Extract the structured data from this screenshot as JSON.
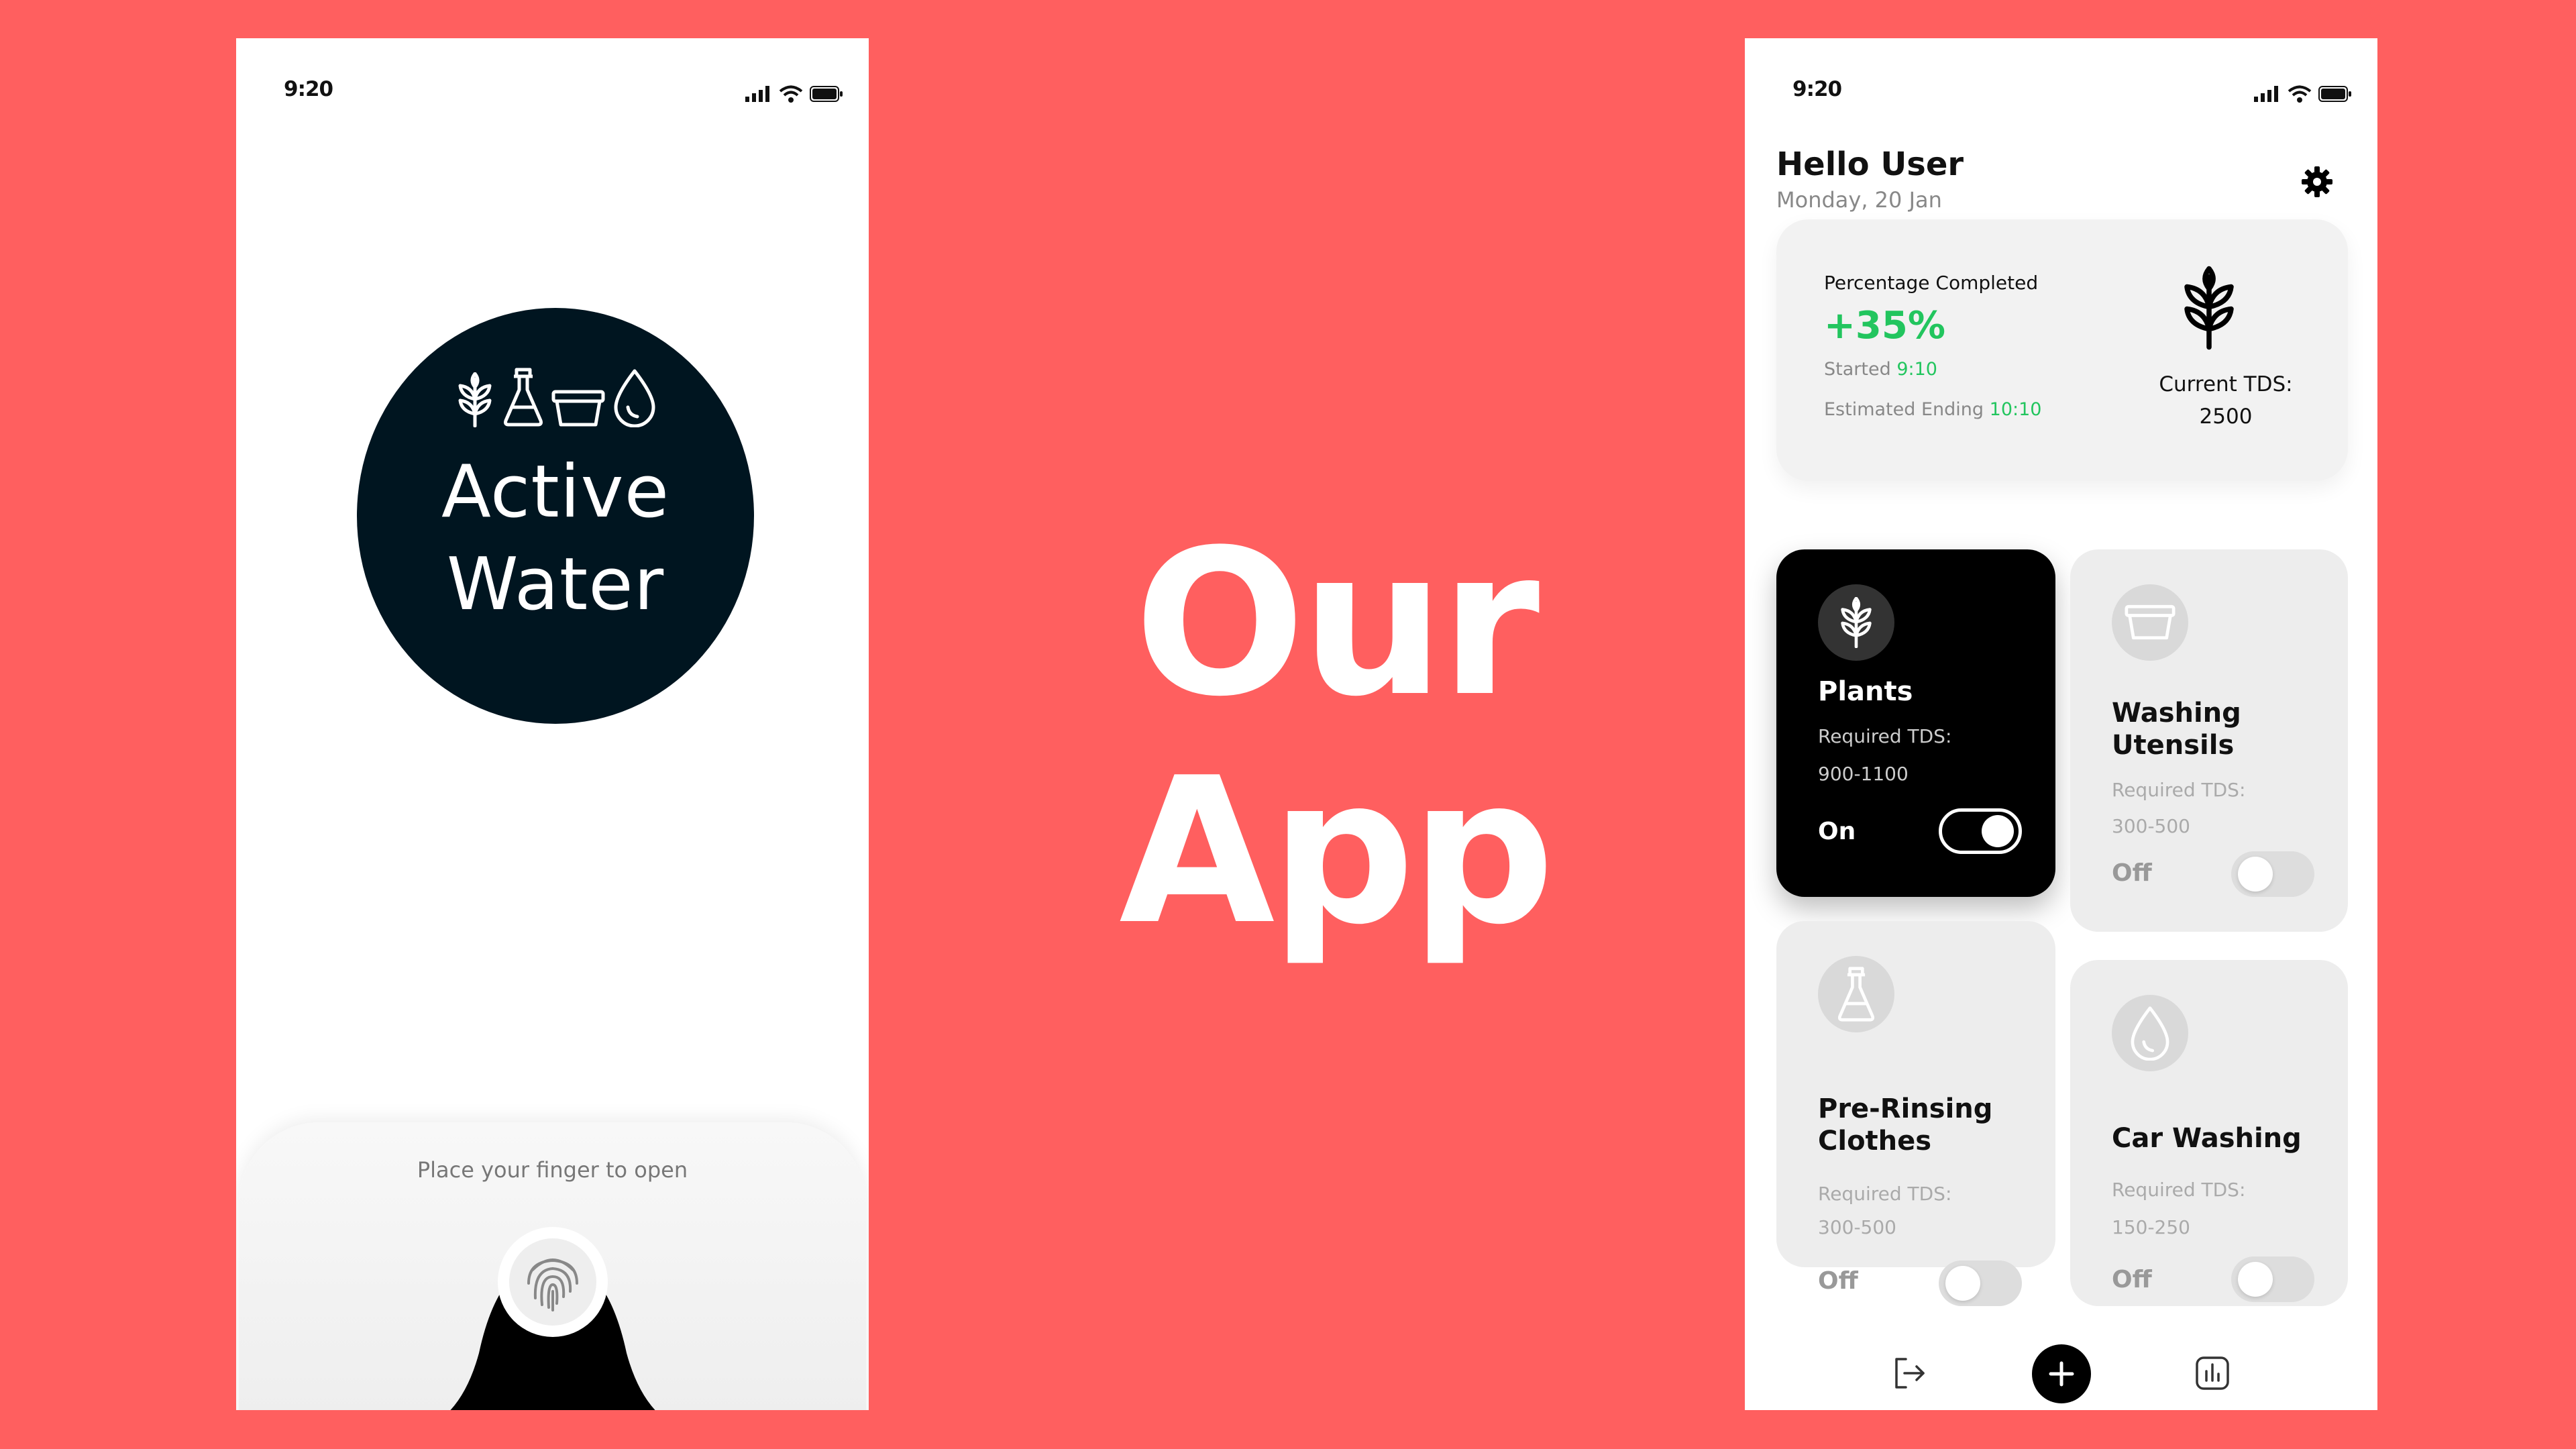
{
  "left_screen": {
    "status_time": "9:20",
    "logo_title": [
      "Active",
      "Water"
    ],
    "logo_icons": [
      "plant-icon",
      "flask-icon",
      "basin-icon",
      "drop-icon"
    ],
    "unlock_hint": "Place your finger to open"
  },
  "center": {
    "title_line1": "Our",
    "title_line2": "App"
  },
  "right_screen": {
    "status_time": "9:20",
    "greeting": "Hello User",
    "date": "Monday, 20 Jan",
    "progress": {
      "title": "Percentage Completed",
      "percent": "+35%",
      "started_label": "Started",
      "started_time": "9:10",
      "ending_label": "Estimated Ending",
      "ending_time": "10:10",
      "tds_label": "Current TDS:",
      "tds_value": "2500"
    },
    "tiles": [
      {
        "name": "Plants",
        "req_label": "Required TDS:",
        "req_value": "900-1100",
        "state": "On",
        "icon": "plant-icon"
      },
      {
        "name": "Washing Utensils",
        "req_label": "Required TDS:",
        "req_value": "300-500",
        "state": "Off",
        "icon": "basin-icon"
      },
      {
        "name": "Pre-Rinsing Clothes",
        "req_label": "Required TDS:",
        "req_value": "300-500",
        "state": "Off",
        "icon": "flask-icon"
      },
      {
        "name": "Car Washing",
        "req_label": "Required TDS:",
        "req_value": "150-250",
        "state": "Off",
        "icon": "drop-icon"
      }
    ],
    "nav": [
      "logout-icon",
      "add-icon",
      "stats-icon"
    ]
  },
  "colors": {
    "background": "#ff5f5f",
    "accent_green": "#22c55e",
    "logo_dark": "#001520"
  }
}
